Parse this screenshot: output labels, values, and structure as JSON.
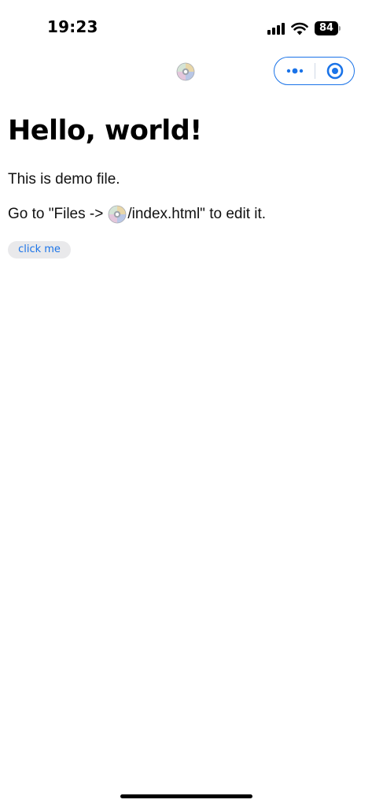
{
  "status_bar": {
    "time": "19:23",
    "signal_icon": "cellular-signal-icon",
    "wifi_icon": "wifi-icon",
    "battery_level": "84"
  },
  "nav_bar": {
    "center_icon": "optical-disc-icon",
    "more_icon": "more-dots-icon",
    "close_icon": "target-close-icon",
    "accent_color": "#1a73e8"
  },
  "content": {
    "title": "Hello, world!",
    "line1": "This is demo file.",
    "line2_prefix": "Go to \"Files ->",
    "line2_icon": "optical-disc-icon",
    "line2_suffix": "/index.html\" to edit it.",
    "button_label": "click me"
  }
}
